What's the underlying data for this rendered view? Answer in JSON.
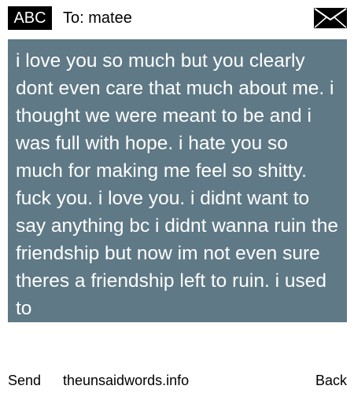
{
  "header": {
    "mode_label": "ABC",
    "recipient": "To: matee",
    "envelope_icon": "envelope-icon"
  },
  "message": {
    "text": "i love you so much but you clearly dont even care that much about me. i thought we were meant to be and i was full with hope. i hate you so much for making me feel so shitty. fuck you. i love you. i didnt want to say anything bc i didnt wanna ruin the friendship but now im not even sure theres a friendship left to ruin. i used to"
  },
  "footer": {
    "send_label": "Send",
    "site_label": "theunsaidwords.info",
    "back_label": "Back"
  },
  "colors": {
    "message_background": "#5f7986",
    "badge_background": "#000000",
    "page_background": "#ffffff"
  }
}
